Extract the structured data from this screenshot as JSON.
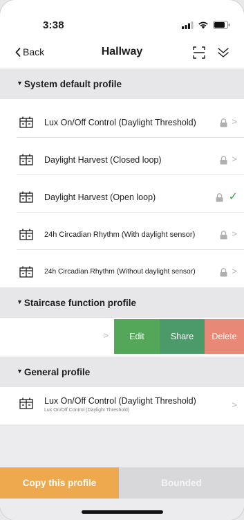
{
  "status_bar": {
    "time": "3:38"
  },
  "navbar": {
    "back_label": "Back",
    "title": "Hallway"
  },
  "sections": [
    {
      "title": "System default profile",
      "items": [
        {
          "label": "Lux On/Off Control (Daylight Threshold)",
          "locked": true,
          "state": "chevron"
        },
        {
          "label": "Daylight Harvest (Closed loop)",
          "locked": true,
          "state": "chevron"
        },
        {
          "label": "Daylight Harvest (Open loop)",
          "locked": true,
          "state": "selected"
        },
        {
          "label": "24h Circadian Rhythm (With daylight sensor)",
          "locked": true,
          "state": "chevron"
        },
        {
          "label": "24h Circadian Rhythm (Without daylight sensor)",
          "locked": true,
          "state": "chevron"
        }
      ]
    },
    {
      "title": "Staircase function profile",
      "swipe_actions": [
        "Edit",
        "Share",
        "Delete"
      ]
    },
    {
      "title": "General profile",
      "items": [
        {
          "label": "Lux On/Off Control (Daylight Threshold)",
          "sublabel": "Lux On/Off Control (Daylight Threshold)"
        }
      ]
    }
  ],
  "bottom_bar": {
    "copy_label": "Copy this profile",
    "bounded_label": "Bounded"
  },
  "colors": {
    "accent_orange": "#eea84d",
    "edit_green": "#54a659",
    "share_green": "#4c9a6a",
    "delete_red": "#e88877",
    "check_green": "#3fa84a"
  }
}
